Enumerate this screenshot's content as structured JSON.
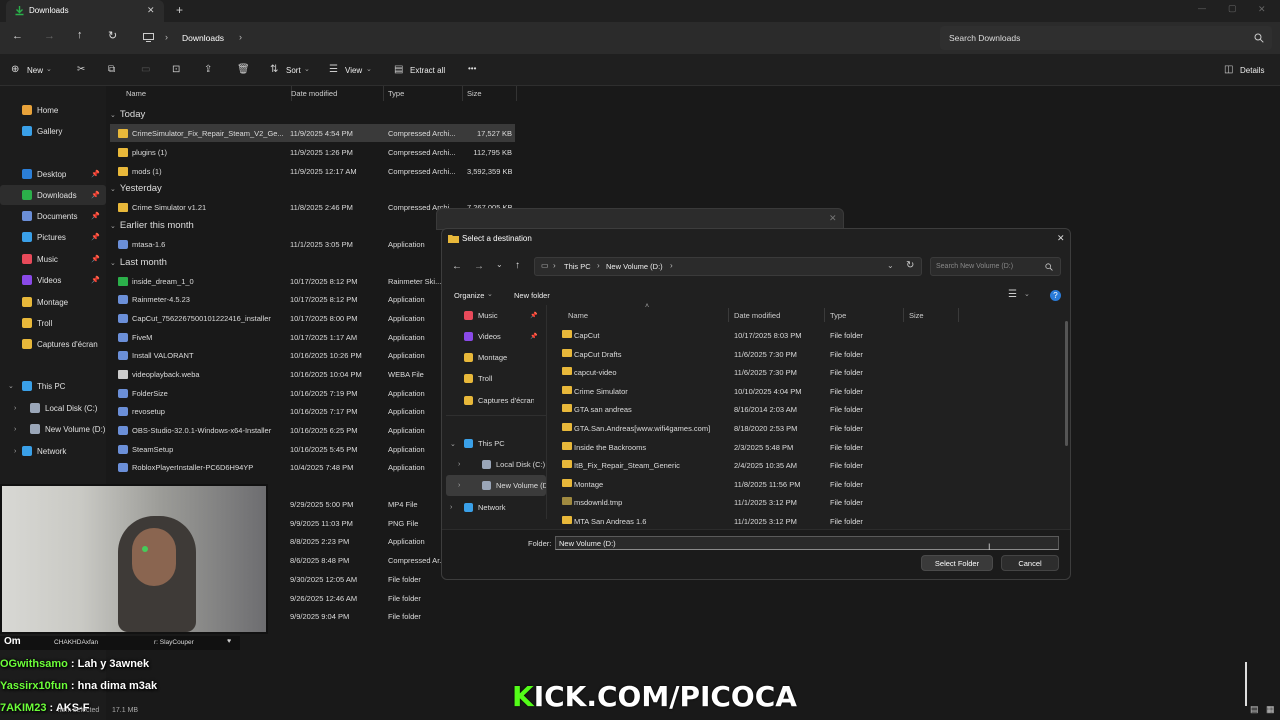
{
  "tab": {
    "title": "Downloads",
    "close": "✕",
    "add": "+"
  },
  "window_controls": {
    "min": "—",
    "max": "▢",
    "close": "✕"
  },
  "address": {
    "crumb": "Downloads",
    "search_placeholder": "Search Downloads"
  },
  "toolbar": {
    "new": "New",
    "sort": "Sort",
    "view": "View",
    "extract": "Extract all",
    "more": "•••",
    "details": "Details"
  },
  "nav": [
    {
      "label": "Home",
      "icon": "home-icon",
      "color": "#e8a23a"
    },
    {
      "label": "Gallery",
      "icon": "gallery-icon",
      "color": "#3aa0e8"
    },
    {
      "label": "Desktop",
      "icon": "desktop-icon",
      "color": "#2b7fd8",
      "pin": true
    },
    {
      "label": "Downloads",
      "icon": "downloads-icon",
      "color": "#2bb04a",
      "pin": true
    },
    {
      "label": "Documents",
      "icon": "documents-icon",
      "color": "#6b8fd8",
      "pin": true
    },
    {
      "label": "Pictures",
      "icon": "pictures-icon",
      "color": "#3aa0e8",
      "pin": true
    },
    {
      "label": "Music",
      "icon": "music-icon",
      "color": "#e84a5a",
      "pin": true
    },
    {
      "label": "Videos",
      "icon": "videos-icon",
      "color": "#8a4ae8",
      "pin": true
    },
    {
      "label": "Montage",
      "icon": "folder-icon",
      "color": "#e8b83a"
    },
    {
      "label": "Troll",
      "icon": "folder-icon",
      "color": "#e8b83a"
    },
    {
      "label": "Captures d'écran",
      "icon": "folder-icon",
      "color": "#e8b83a"
    },
    {
      "label": "This PC",
      "icon": "pc-icon",
      "color": "#3aa0e8"
    },
    {
      "label": "Local Disk (C:)",
      "icon": "drive-icon",
      "color": "#9aa6b8"
    },
    {
      "label": "New Volume (D:)",
      "icon": "drive-icon",
      "color": "#9aa6b8"
    },
    {
      "label": "Network",
      "icon": "network-icon",
      "color": "#3aa0e8"
    }
  ],
  "columns": {
    "name": "Name",
    "date": "Date modified",
    "type": "Type",
    "size": "Size"
  },
  "groups": {
    "today": "Today",
    "yesterday": "Yesterday",
    "earlier": "Earlier this month",
    "last": "Last month"
  },
  "files": [
    {
      "name": "CrimeSimulator_Fix_Repair_Steam_V2_Ge...",
      "date": "11/9/2025 4:54 PM",
      "type": "Compressed Archi...",
      "size": "17,527 KB",
      "icon": "archive"
    },
    {
      "name": "plugins (1)",
      "date": "11/9/2025 1:26 PM",
      "type": "Compressed Archi...",
      "size": "112,795 KB",
      "icon": "archive"
    },
    {
      "name": "mods (1)",
      "date": "11/9/2025 12:17 AM",
      "type": "Compressed Archi...",
      "size": "3,592,359 KB",
      "icon": "archive"
    },
    {
      "name": "Crime Simulator v1.21",
      "date": "11/8/2025 2:46 PM",
      "type": "Compressed Archi...",
      "size": "7,267,005 KB",
      "icon": "archive"
    },
    {
      "name": "mtasa-1.6",
      "date": "11/1/2025 3:05 PM",
      "type": "Application",
      "size": "",
      "icon": "app"
    },
    {
      "name": "inside_dream_1_0",
      "date": "10/17/2025 8:12 PM",
      "type": "Rainmeter Ski...",
      "size": "",
      "icon": "drop"
    },
    {
      "name": "Rainmeter-4.5.23",
      "date": "10/17/2025 8:12 PM",
      "type": "Application",
      "size": "",
      "icon": "app"
    },
    {
      "name": "CapCut_7562267500101222416_installer",
      "date": "10/17/2025 8:00 PM",
      "type": "Application",
      "size": "",
      "icon": "app"
    },
    {
      "name": "FiveM",
      "date": "10/17/2025 1:17 AM",
      "type": "Application",
      "size": "",
      "icon": "app"
    },
    {
      "name": "Install VALORANT",
      "date": "10/16/2025 10:26 PM",
      "type": "Application",
      "size": "",
      "icon": "app"
    },
    {
      "name": "videoplayback.weba",
      "date": "10/16/2025 10:04 PM",
      "type": "WEBA File",
      "size": "",
      "icon": "doc"
    },
    {
      "name": "FolderSize",
      "date": "10/16/2025 7:19 PM",
      "type": "Application",
      "size": "",
      "icon": "app"
    },
    {
      "name": "revosetup",
      "date": "10/16/2025 7:17 PM",
      "type": "Application",
      "size": "",
      "icon": "app"
    },
    {
      "name": "OBS-Studio-32.0.1-Windows-x64-Installer",
      "date": "10/16/2025 6:25 PM",
      "type": "Application",
      "size": "",
      "icon": "app"
    },
    {
      "name": "SteamSetup",
      "date": "10/16/2025 5:45 PM",
      "type": "Application",
      "size": "",
      "icon": "app"
    },
    {
      "name": "RobloxPlayerInstaller-PC6D6H94YP",
      "date": "10/4/2025 7:48 PM",
      "type": "Application",
      "size": "",
      "icon": "app"
    },
    {
      "name": "",
      "date": "9/29/2025 5:00 PM",
      "type": "MP4 File",
      "size": "",
      "icon": "none"
    },
    {
      "name": "",
      "date": "9/9/2025 11:03 PM",
      "type": "PNG File",
      "size": "",
      "icon": "none"
    },
    {
      "name": "",
      "date": "8/8/2025 2:23 PM",
      "type": "Application",
      "size": "",
      "icon": "none"
    },
    {
      "name": "",
      "date": "8/6/2025 8:48 PM",
      "type": "Compressed Ar...",
      "size": "",
      "icon": "none"
    },
    {
      "name": "",
      "date": "9/30/2025 12:05 AM",
      "type": "File folder",
      "size": "",
      "icon": "none"
    },
    {
      "name": "",
      "date": "9/26/2025 12:46 AM",
      "type": "File folder",
      "size": "",
      "icon": "none"
    },
    {
      "name": "",
      "date": "9/9/2025 9:04 PM",
      "type": "File folder",
      "size": "",
      "icon": "none"
    }
  ],
  "dialog": {
    "title": "Select a destination",
    "path_root": "This PC",
    "path_current": "New Volume (D:)",
    "search_placeholder": "Search New Volume (D:)",
    "organize": "Organize",
    "new_folder": "New folder",
    "columns": {
      "name": "Name",
      "date": "Date modified",
      "type": "Type",
      "size": "Size"
    },
    "nav": [
      {
        "label": "Music",
        "icon": "music-icon",
        "color": "#e84a5a",
        "pin": true
      },
      {
        "label": "Videos",
        "icon": "videos-icon",
        "color": "#8a4ae8",
        "pin": true
      },
      {
        "label": "Montage",
        "icon": "folder-icon",
        "color": "#e8b83a"
      },
      {
        "label": "Troll",
        "icon": "folder-icon",
        "color": "#e8b83a"
      },
      {
        "label": "Captures d'écran",
        "icon": "folder-icon",
        "color": "#e8b83a"
      },
      {
        "label": "This PC",
        "icon": "pc-icon",
        "color": "#3aa0e8"
      },
      {
        "label": "Local Disk (C:)",
        "icon": "drive-icon",
        "color": "#9aa6b8"
      },
      {
        "label": "New Volume (D:)",
        "icon": "drive-icon",
        "color": "#9aa6b8"
      },
      {
        "label": "Network",
        "icon": "network-icon",
        "color": "#3aa0e8"
      }
    ],
    "folders": [
      {
        "name": "CapCut",
        "date": "10/17/2025 8:03 PM",
        "type": "File folder"
      },
      {
        "name": "CapCut Drafts",
        "date": "11/6/2025 7:30 PM",
        "type": "File folder"
      },
      {
        "name": "capcut-video",
        "date": "11/6/2025 7:30 PM",
        "type": "File folder"
      },
      {
        "name": "Crime Simulator",
        "date": "10/10/2025 4:04 PM",
        "type": "File folder"
      },
      {
        "name": "GTA san andreas",
        "date": "8/16/2014 2:03 AM",
        "type": "File folder"
      },
      {
        "name": "GTA.San.Andreas[www.wifi4games.com]",
        "date": "8/18/2020 2:53 PM",
        "type": "File folder"
      },
      {
        "name": "Inside the Backrooms",
        "date": "2/3/2025 5:48 PM",
        "type": "File folder"
      },
      {
        "name": "ItB_Fix_Repair_Steam_Generic",
        "date": "2/4/2025 10:35 AM",
        "type": "File folder"
      },
      {
        "name": "Montage",
        "date": "11/8/2025 11:56 PM",
        "type": "File folder"
      },
      {
        "name": "msdownld.tmp",
        "date": "11/1/2025 3:12 PM",
        "type": "File folder"
      },
      {
        "name": "MTA San Andreas 1.6",
        "date": "11/1/2025 3:12 PM",
        "type": "File folder"
      }
    ],
    "folder_label": "Folder:",
    "folder_value": "New Volume (D:)",
    "select_button": "Select Folder",
    "cancel_button": "Cancel"
  },
  "overlay": {
    "webcam_caption_left": "CHAKHDAxfan",
    "webcam_caption_right": "r: SlayCouper",
    "chat_partial": "Om",
    "chat": [
      {
        "user": "OGwithsamo",
        "msg": " : Lah y 3awnek"
      },
      {
        "user": "Yassirx10fun",
        "msg": " : hna dima m3ak"
      },
      {
        "user": "7AKIM23",
        "msg": " : AKS-F"
      }
    ],
    "kick_k": "K",
    "kick_rest": "ICK.COM/PICOCA"
  },
  "statusbar": {
    "selected": "item selected",
    "size": "17.1 MB"
  }
}
